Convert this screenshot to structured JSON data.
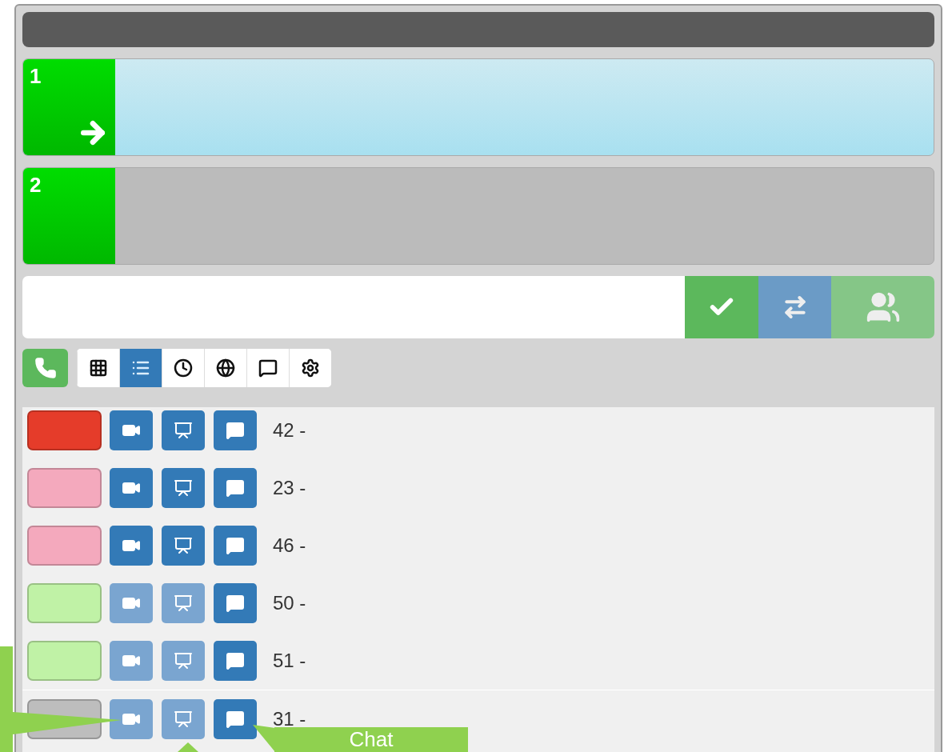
{
  "lines": [
    {
      "number": "1",
      "selected": true
    },
    {
      "number": "2",
      "selected": false
    }
  ],
  "toolbar": [
    {
      "kind": "dialpad",
      "selected": false
    },
    {
      "kind": "list",
      "selected": true
    },
    {
      "kind": "history",
      "selected": false
    },
    {
      "kind": "globe",
      "selected": false
    },
    {
      "kind": "chat",
      "selected": false
    },
    {
      "kind": "settings",
      "selected": false
    }
  ],
  "contacts": [
    {
      "color": "#e53c2a",
      "video_disabled": false,
      "screen_disabled": false,
      "label": "42 -"
    },
    {
      "color": "#f4a9bd",
      "video_disabled": false,
      "screen_disabled": false,
      "label": "23 -"
    },
    {
      "color": "#f4a9bd",
      "video_disabled": false,
      "screen_disabled": false,
      "label": "46 -"
    },
    {
      "color": "#c0f2a6",
      "video_disabled": true,
      "screen_disabled": true,
      "label": "50 -"
    },
    {
      "color": "#c0f2a6",
      "video_disabled": true,
      "screen_disabled": true,
      "label": "51 -"
    },
    {
      "color": "#bdbdbd",
      "video_disabled": true,
      "screen_disabled": true,
      "label": "31 -"
    }
  ],
  "callout": {
    "label": "Chat"
  }
}
